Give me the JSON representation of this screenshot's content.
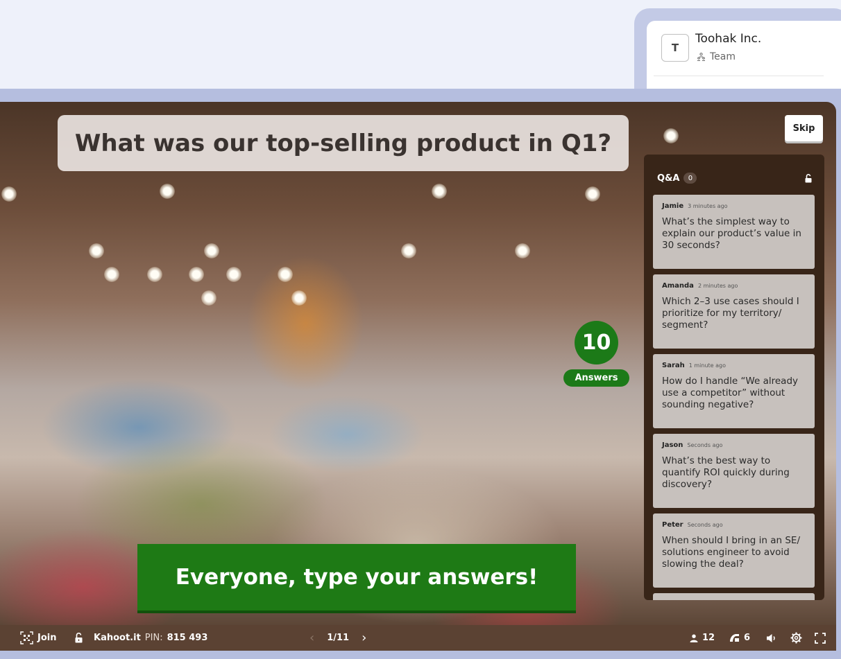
{
  "workspace": {
    "avatar_letter": "T",
    "name": "Toohak Inc.",
    "type": "Team",
    "type_icon": "team-icon"
  },
  "stage": {
    "question": "What was our top-selling product in Q1?",
    "skip_label": "Skip",
    "answers_count": "10",
    "answers_label": "Answers",
    "instruction": "Everyone, type your answers!",
    "instruction_color": "#1e7a15"
  },
  "qa": {
    "title": "Q&A",
    "count": "0",
    "lock_icon": "unlock-icon",
    "items": [
      {
        "author": "Jamie",
        "time": "3 minutes ago",
        "text": "What’s the simplest way to explain our product’s value in 30 seconds?"
      },
      {
        "author": "Amanda",
        "time": "2 minutes ago",
        "text": "Which 2–3 use cases should I prioritize for my territory/ segment?"
      },
      {
        "author": "Sarah",
        "time": "1 minute ago",
        "text": "How do I handle “We already use a competitor” without sounding negative?"
      },
      {
        "author": "Jason",
        "time": "Seconds ago",
        "text": "What’s the best way to quantify ROI quickly during discovery?"
      },
      {
        "author": "Peter",
        "time": "Seconds ago",
        "text": "When should I bring in an SE/ solutions engineer to avoid slowing the deal?"
      },
      {
        "author": "",
        "time": "",
        "text": ""
      }
    ]
  },
  "bottom": {
    "join_label": "Join",
    "site": "Kahoot.it",
    "pin_label": "PIN:",
    "pin": "815 493",
    "slide_position": "1/11",
    "players": "12",
    "answers": "6"
  }
}
